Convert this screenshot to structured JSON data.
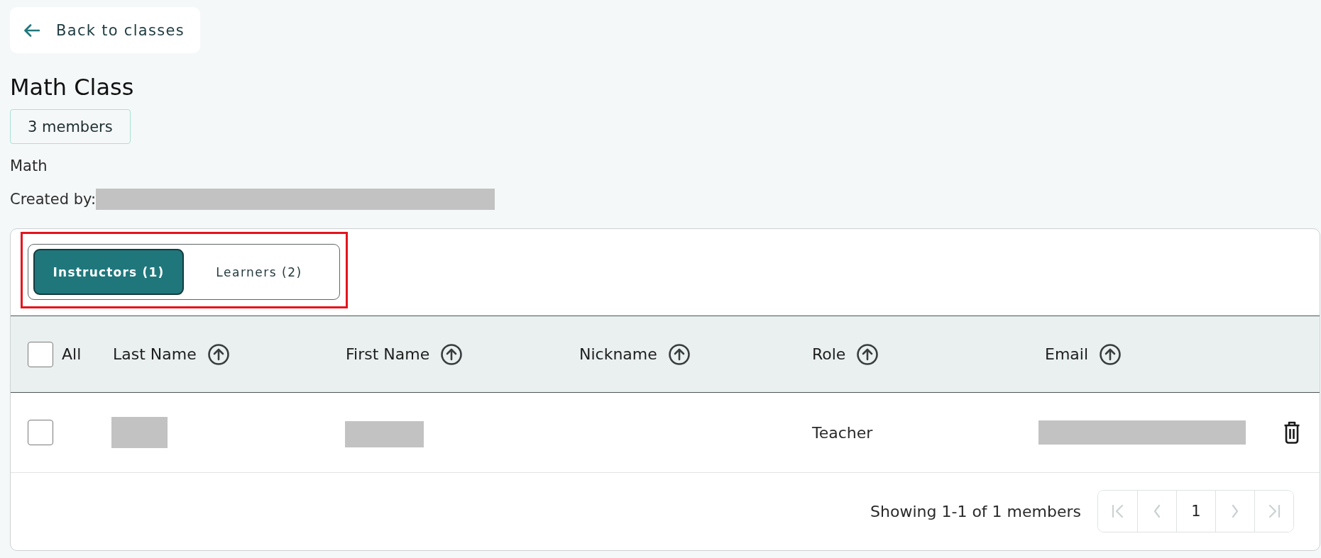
{
  "back_button": {
    "label": "Back to classes"
  },
  "class": {
    "title": "Math Class",
    "member_count": "3 members",
    "subject": "Math",
    "created_by_label": "Created by:"
  },
  "tab_group": {
    "highlighted": true,
    "tabs": [
      {
        "label": "Instructors (1)",
        "selected": true
      },
      {
        "label": "Learners (2)",
        "selected": false
      }
    ]
  },
  "table": {
    "select_all": {
      "label": "All",
      "checked": false
    },
    "columns": [
      {
        "label": "Last Name",
        "sort_ascending": true
      },
      {
        "label": "First Name",
        "sort_ascending": true
      },
      {
        "label": "Nickname",
        "sort_ascending": true
      },
      {
        "label": "Role",
        "sort_ascending": true
      },
      {
        "label": "Email",
        "sort_ascending": true
      }
    ],
    "rows": [
      {
        "checked": false,
        "role": "Teacher"
      }
    ]
  },
  "footer": {
    "summary": "Showing 1-1 of 1 members",
    "pagination": [
      {
        "kind": "first",
        "disabled": true
      },
      {
        "kind": "previous",
        "disabled": true
      },
      {
        "kind": "page",
        "label": "1"
      },
      {
        "kind": "next",
        "disabled": true
      },
      {
        "kind": "last",
        "disabled": true
      }
    ]
  }
}
